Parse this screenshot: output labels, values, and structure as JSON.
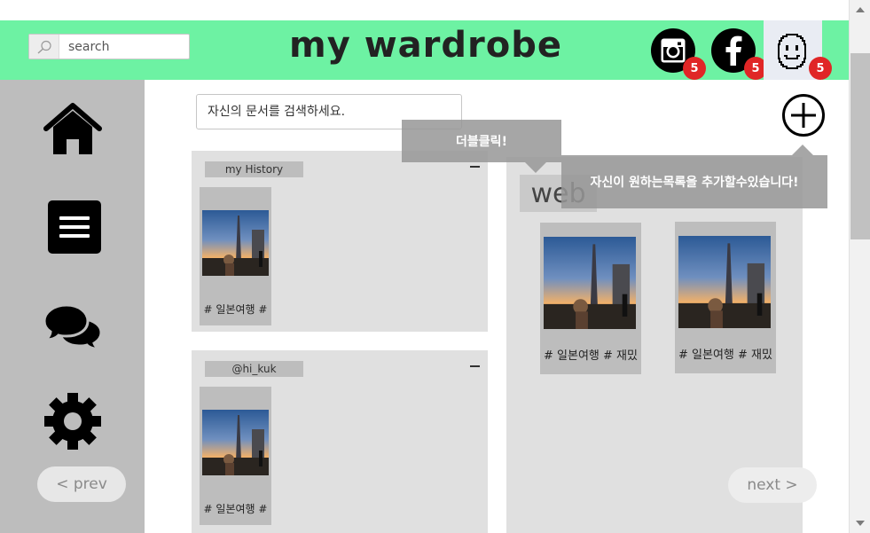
{
  "header": {
    "title": "my wardrobe",
    "search_placeholder": "search",
    "accent": "#6df2a3",
    "social": [
      {
        "name": "instagram",
        "icon": "instagram-icon",
        "badge": "5"
      },
      {
        "name": "facebook",
        "icon": "facebook-icon",
        "badge": "5"
      },
      {
        "name": "profile",
        "icon": "smiley-face-icon",
        "badge": "5"
      }
    ],
    "badge_color": "#e02626"
  },
  "sidebar": {
    "items": [
      {
        "icon": "home-icon"
      },
      {
        "icon": "menu-list-icon"
      },
      {
        "icon": "chat-bubbles-icon"
      },
      {
        "icon": "gear-icon"
      }
    ],
    "prev_label": "< prev"
  },
  "main": {
    "doc_search_placeholder": "자신의 문서를 검색하세요.",
    "add_icon": "plus-circle-icon",
    "next_label": "next >",
    "panels": [
      {
        "label": "my History",
        "cards": [
          {
            "tag": "# 일본여행 #"
          }
        ]
      },
      {
        "label": "@hi_kuk",
        "cards": [
          {
            "tag": "# 일본여행 #"
          }
        ]
      }
    ],
    "web": {
      "label": "web",
      "cards": [
        {
          "tag": "# 일본여행 # 재밌"
        },
        {
          "tag": "# 일본여행 # 재밌"
        }
      ]
    }
  },
  "tooltips": {
    "double_click": "더블클릭!",
    "add_category": "자신이 원하는목록을 추가할수있습니다!"
  }
}
